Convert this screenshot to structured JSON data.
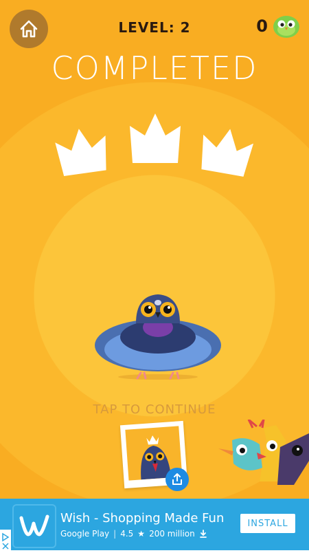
{
  "hud": {
    "level_text": "LEVEL: 2",
    "coins": "0",
    "home_icon": "home-icon",
    "coin_icon": "green-bird-coin-icon"
  },
  "result": {
    "title": "COMPLETED",
    "crowns_earned": 3,
    "crowns_total": 3
  },
  "prompt": {
    "tap_text": "TAP TO CONTINUE"
  },
  "share": {
    "icon": "share-icon"
  },
  "ad": {
    "title": "Wish - Shopping Made Fun",
    "store": "Google Play",
    "rating": "4.5",
    "downloads": "200 million",
    "install_label": "INSTALL",
    "logo_letter": "w"
  },
  "colors": {
    "background": "#fbb82c",
    "inner_circle": "#fcc53a",
    "home_button": "#b07a2c",
    "ad_bar": "#2ca6e0",
    "share_button": "#1e8be3"
  }
}
